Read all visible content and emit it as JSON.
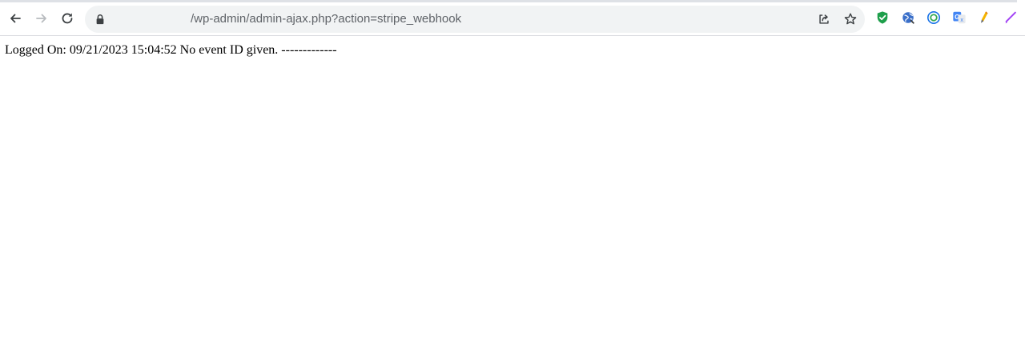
{
  "browser": {
    "url": "/wp-admin/admin-ajax.php?action=stripe_webhook",
    "icons": {
      "back": "arrow-left-icon",
      "forward": "arrow-right-icon",
      "reload": "reload-icon",
      "lock": "lock-icon",
      "share": "share-icon",
      "bookmark": "star-icon"
    },
    "extensions": [
      "shield-check-extension-icon",
      "globe-extension-icon",
      "circle-ring-extension-icon",
      "google-translate-extension-icon",
      "pen-extension-icon",
      "pencil-extension-icon"
    ],
    "colors": {
      "toolbar_bg": "#ffffff",
      "omnibox_bg": "#f1f3f4",
      "icon_gray": "#5f6368",
      "shield_green": "#1e9f4b",
      "translate_blue": "#4285f4"
    }
  },
  "page": {
    "text": "Logged On: 09/21/2023 15:04:52 No event ID given. -------------"
  }
}
